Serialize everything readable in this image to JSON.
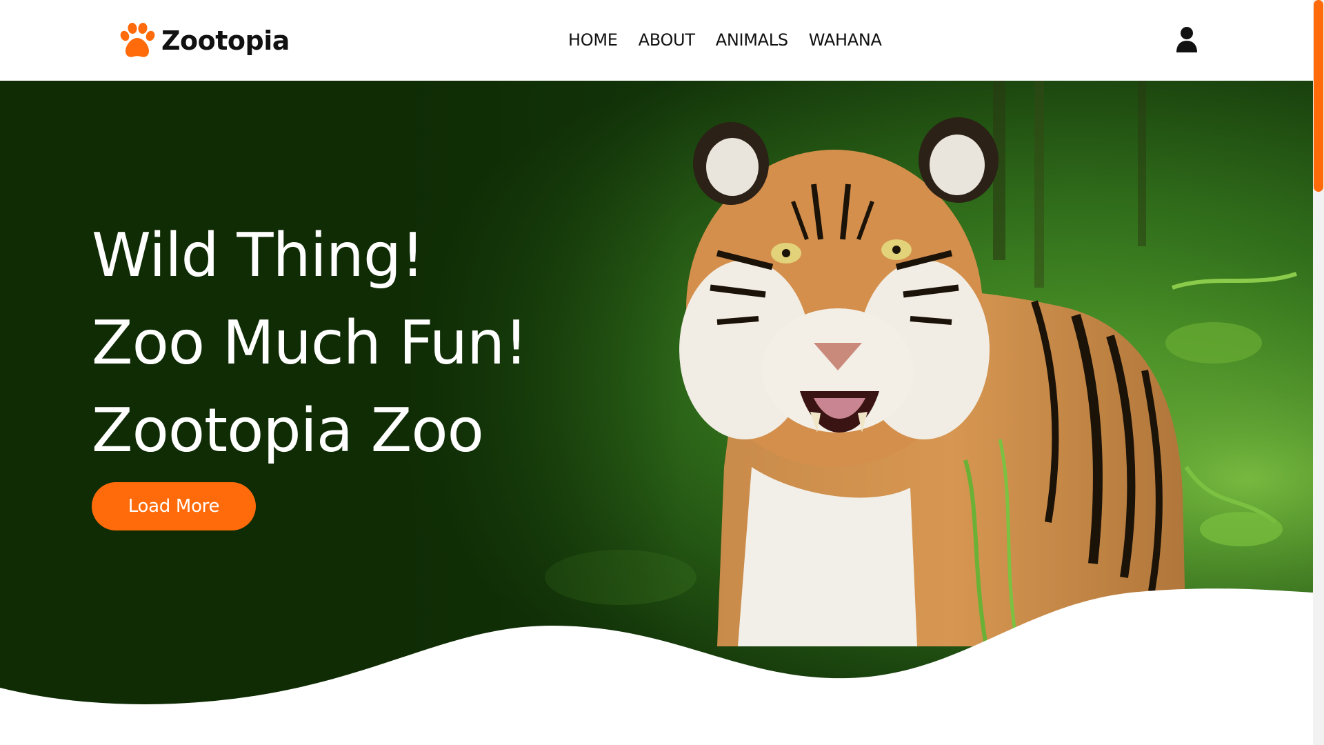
{
  "brand": {
    "name": "Zootopia",
    "logo_icon": "paw-icon",
    "accent_color": "#ff6b0a"
  },
  "nav": {
    "items": [
      {
        "label": "HOME"
      },
      {
        "label": "ABOUT"
      },
      {
        "label": "ANIMALS"
      },
      {
        "label": "WAHANA"
      }
    ],
    "user_icon": "user-icon"
  },
  "hero": {
    "lines": [
      "Wild Thing!",
      "Zoo Much Fun!",
      "Zootopia Zoo"
    ],
    "button_label": "Load More",
    "background_color": "#0f2c05",
    "image_subject": "tiger-in-jungle"
  }
}
